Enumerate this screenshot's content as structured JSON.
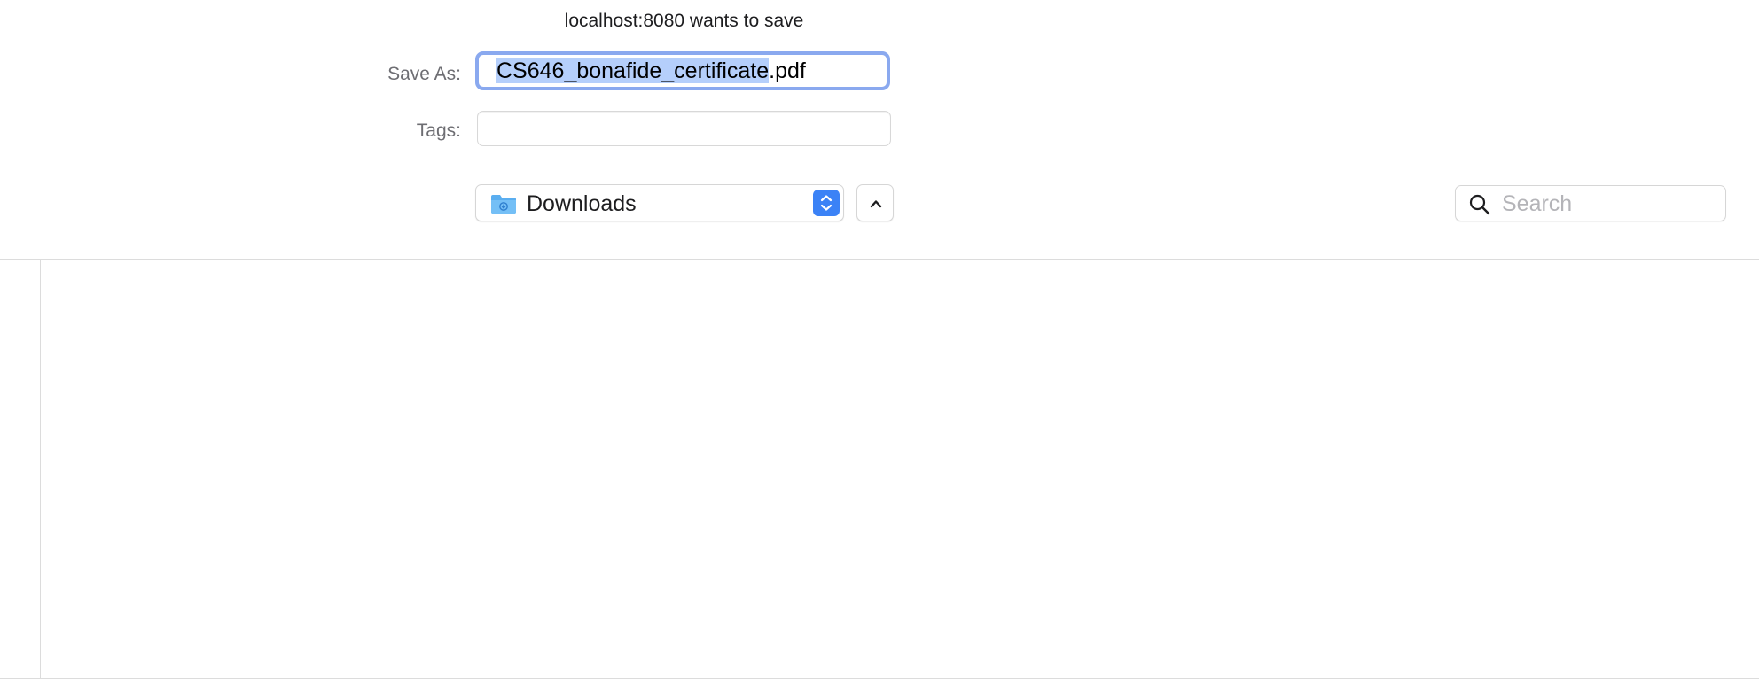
{
  "dialog": {
    "title": "localhost:8080 wants to save"
  },
  "save_as": {
    "label": "Save As:",
    "filename_selected": "CS646_bonafide_certificate",
    "filename_extension": ".pdf"
  },
  "tags": {
    "label": "Tags:",
    "value": ""
  },
  "location": {
    "folder": "Downloads",
    "folder_icon": "folder-icon",
    "stepper_icon": "up-down-chevron-icon"
  },
  "expand": {
    "icon": "chevron-up-icon"
  },
  "search": {
    "placeholder": "Search",
    "icon": "search-icon"
  },
  "colors": {
    "accent": "#3b82f6",
    "focus_ring": "#8aa9ef",
    "selection": "#b5cffb"
  }
}
